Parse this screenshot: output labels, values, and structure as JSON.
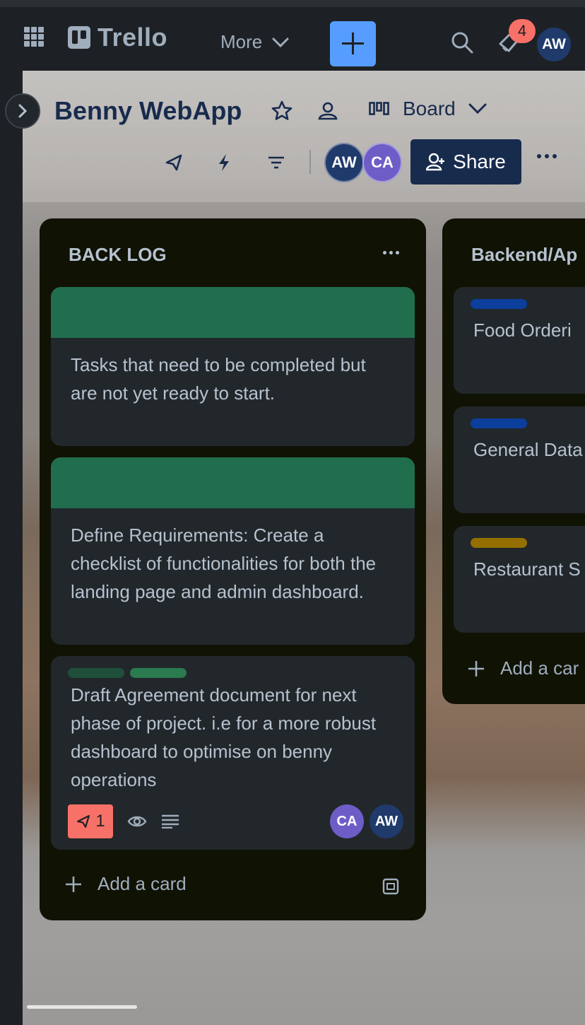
{
  "topnav": {
    "logo_text": "Trello",
    "more_label": "More",
    "notification_count": "4",
    "user_initials": "AW"
  },
  "board": {
    "title": "Benny WebApp",
    "view_label": "Board",
    "members": [
      {
        "initials": "AW",
        "color": "#1f3a6b"
      },
      {
        "initials": "CA",
        "color": "#6e5dc6"
      }
    ],
    "share_label": "Share"
  },
  "lists": [
    {
      "title": "BACK LOG",
      "cards": [
        {
          "cover_color": "#216e4e",
          "text": "Tasks that need to be completed but are not yet ready to start."
        },
        {
          "cover_color": "#216e4e",
          "text": "Define Requirements: Create a checklist of functionalities for both the landing page and admin dashboard."
        },
        {
          "labels": [
            "#1f4f3a",
            "#2b7a50"
          ],
          "text": "Draft Agreement document for next phase of project. i.e for a more robust dashboard to optimise on benny operations",
          "due_count": "1",
          "members": [
            "CA",
            "AW"
          ]
        }
      ],
      "add_card_label": "Add a card"
    },
    {
      "title": "Backend/Ap",
      "cards": [
        {
          "label_color": "#0c3e9c",
          "text": "Food Orderi"
        },
        {
          "label_color": "#0c3e9c",
          "text": "General Data"
        },
        {
          "label_color": "#946f00",
          "text": "Restaurant S"
        }
      ],
      "add_card_label": "Add a car"
    }
  ]
}
